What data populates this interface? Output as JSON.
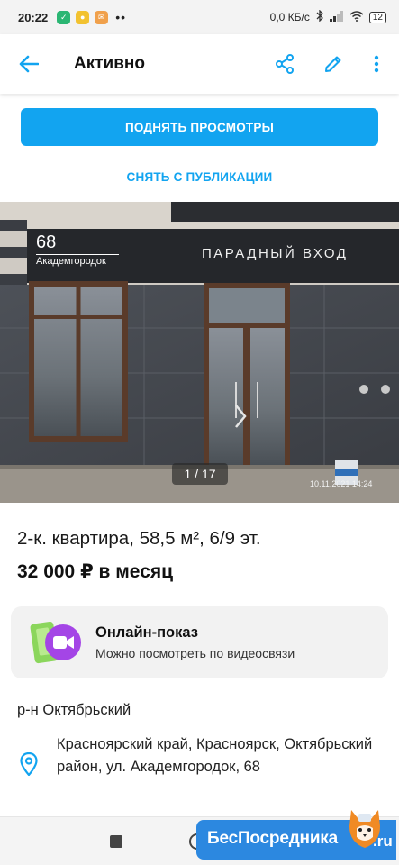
{
  "status_bar": {
    "time": "20:22",
    "net_speed": "0,0 КБ/с",
    "battery": "12"
  },
  "app_bar": {
    "title": "Активно",
    "back_icon": "arrow-back-icon",
    "share_icon": "share-icon",
    "edit_icon": "pencil-icon",
    "more_icon": "more-vert-icon"
  },
  "actions": {
    "primary": "ПОДНЯТЬ ПРОСМОТРЫ",
    "secondary": "СНЯТЬ С ПУБЛИКАЦИИ"
  },
  "photo": {
    "house_number": "68",
    "street_sign": "Академгородок",
    "signboard": "ПАРАДНЫЙ ВХОД",
    "timestamp": "10.11.2021  14:24",
    "counter": "1 / 17"
  },
  "listing": {
    "title": "2-к. квартира, 58,5 м², 6/9 эт.",
    "price": "32 000 ₽ в месяц"
  },
  "online_show": {
    "title": "Онлайн-показ",
    "subtitle": "Можно посмотреть по видеосвязи",
    "icon": "video-call-icon"
  },
  "location": {
    "district": "р-н Октябрьский",
    "address": "Красноярский край, Красноярск, Октябрьский район, ул. Академгородок, 68",
    "icon": "location-pin-icon"
  },
  "watermark": {
    "brand": "БесПосредника",
    "tld": ".ru"
  },
  "colors": {
    "accent": "#12a4f0",
    "badge": "#2c88e0"
  }
}
